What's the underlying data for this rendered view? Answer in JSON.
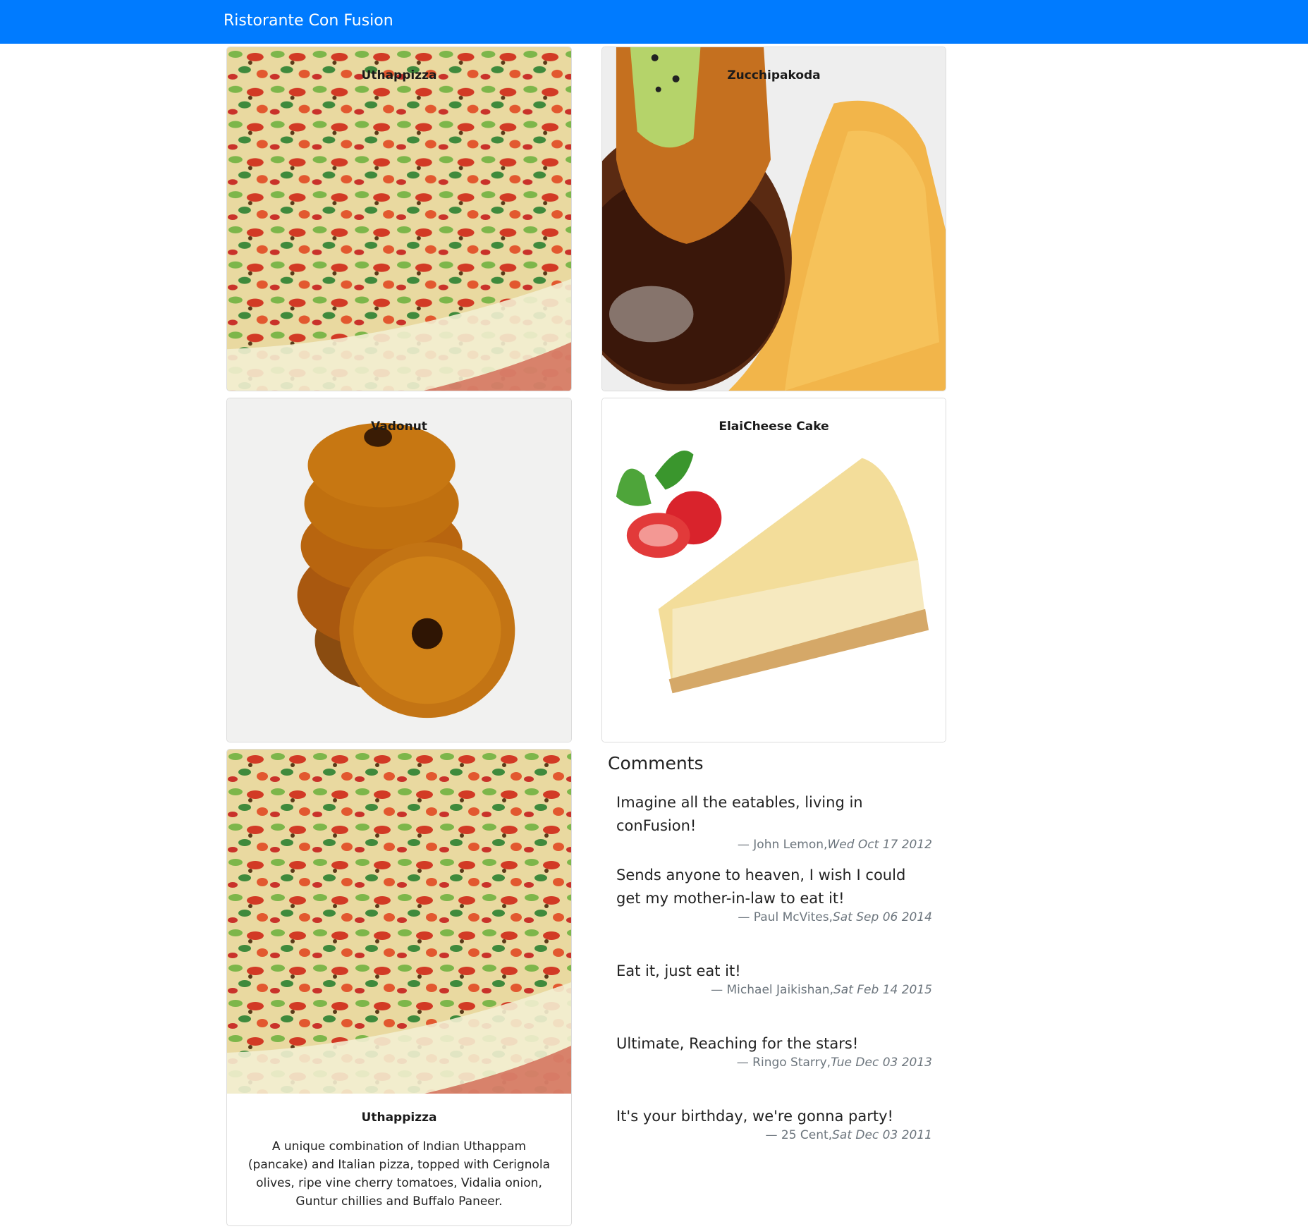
{
  "navbar": {
    "brand": "Ristorante Con Fusion"
  },
  "menu": [
    {
      "name": "Uthappizza",
      "image": "pizza"
    },
    {
      "name": "Zucchipakoda",
      "image": "pakoda"
    },
    {
      "name": "Vadonut",
      "image": "vadonut"
    },
    {
      "name": "ElaiCheese Cake",
      "image": "cheesecake"
    }
  ],
  "selected_dish": {
    "name": "Uthappizza",
    "description": "A unique combination of Indian Uthappam (pancake) and Italian pizza, topped with Cerignola olives, ripe vine cherry tomatoes, Vidalia onion, Guntur chillies and Buffalo Paneer."
  },
  "comments": {
    "heading": "Comments",
    "items": [
      {
        "text": "Imagine all the eatables, living in conFusion!",
        "author": "— John Lemon,",
        "date": "Wed Oct 17 2012"
      },
      {
        "text": "Sends anyone to heaven, I wish I could get my mother-in-law to eat it!",
        "author": "— Paul McVites,",
        "date": "Sat Sep 06 2014"
      },
      {
        "text": "Eat it, just eat it!",
        "author": "— Michael Jaikishan,",
        "date": "Sat Feb 14 2015"
      },
      {
        "text": "Ultimate, Reaching for the stars!",
        "author": "— Ringo Starry,",
        "date": "Tue Dec 03 2013"
      },
      {
        "text": "It's your birthday, we're gonna party!",
        "author": "— 25 Cent,",
        "date": "Sat Dec 03 2011"
      }
    ]
  }
}
